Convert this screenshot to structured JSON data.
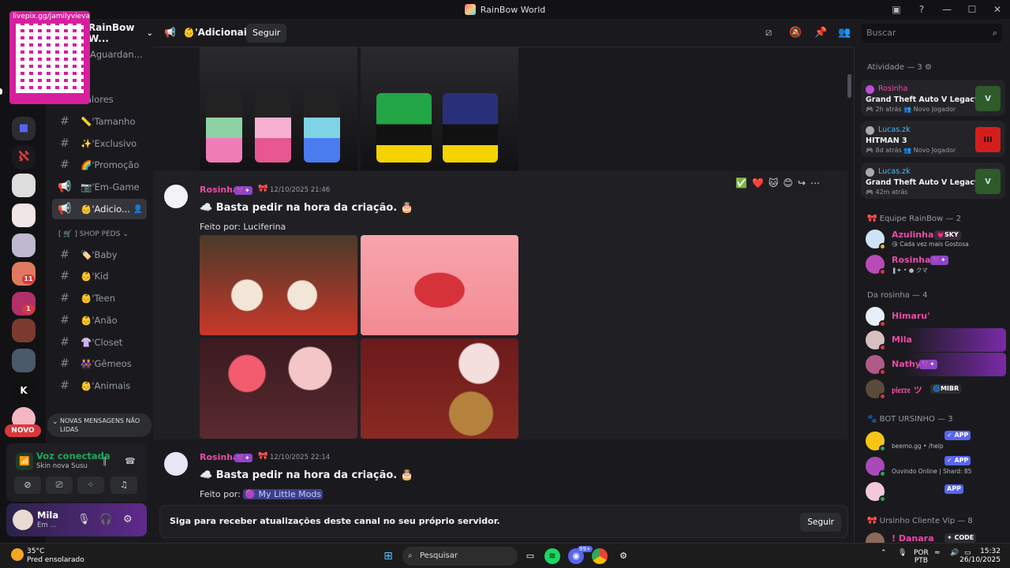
{
  "titlebar": {
    "title": "RainBow World"
  },
  "qr": {
    "url": "livepix.gg/jamilyvieva"
  },
  "server": {
    "name": "RainBow W...",
    "pending": "Aguardan..."
  },
  "rail": {
    "badges": [
      "11",
      "1"
    ],
    "novo": "NOVO"
  },
  "channels": [
    {
      "label": "Valores",
      "icon": ""
    },
    {
      "label": "📏'Tamanho",
      "icon": "#"
    },
    {
      "label": "✨'Exclusivo",
      "icon": "#"
    },
    {
      "label": "🌈'Promoção",
      "icon": "#"
    },
    {
      "label": "📷'Em-Game",
      "icon": "📢"
    },
    {
      "label": "👶'Adicio...",
      "icon": "📢"
    },
    {
      "label": "🏷️'Baby",
      "icon": "#"
    },
    {
      "label": "👶'Kid",
      "icon": "#"
    },
    {
      "label": "👶'Teen",
      "icon": "#"
    },
    {
      "label": "👶'Anão",
      "icon": "#"
    },
    {
      "label": "👚'Closet",
      "icon": "#"
    },
    {
      "label": "👭'Gêmeos",
      "icon": "#"
    },
    {
      "label": "👶'Animais",
      "icon": "#"
    }
  ],
  "category": "[ 🛒 ] SHOP PEDS ⌄",
  "unread_label": "NOVAS MENSAGENS NÃO LIDAS",
  "voice": {
    "status": "Voz conectada",
    "channel": "Skin nova Susu"
  },
  "user": {
    "name": "Mila",
    "status": "Em ..."
  },
  "chat_header": {
    "channel": "👶'Adicionais",
    "follow": "Seguir"
  },
  "search": {
    "placeholder": "Buscar"
  },
  "messages": [
    {
      "author": "Rosinha",
      "time": "12/10/2025 21:46",
      "text": "☁️ Basta pedir na hora da criação. 🎂",
      "credit_prefix": "Feito por:",
      "credit": "Luciferina"
    },
    {
      "author": "Rosinha",
      "time": "12/10/2025 22:14",
      "text": "☁️ Basta pedir na hora da criação. 🎂",
      "credit_prefix": "Feito por:",
      "credit": "🟣 My Little Mods"
    }
  ],
  "reactions": [
    "✅",
    "❤️",
    "🐱",
    "😊",
    "↪",
    "⋯"
  ],
  "notice": {
    "text": "Siga para receber atualizações deste canal no seu próprio servidor.",
    "button": "Seguir"
  },
  "members": {
    "activity_title": "Atividade — 3",
    "activities": [
      {
        "user": "Rosinha",
        "game": "Grand Theft Auto V Legacy",
        "meta": "🎮 2h atrás  👥 Novo Jogador",
        "icon": "V"
      },
      {
        "user": "Lucas.zk",
        "game": "HITMAN 3",
        "meta": "🎮 8d atrás  👥 Novo Jogador",
        "icon": "III"
      },
      {
        "user": "Lucas.zk",
        "game": "Grand Theft Auto V Legacy",
        "meta": "🎮 42m atrás",
        "icon": "V"
      }
    ],
    "group1_title": "🎀 Equipe RainBow — 2",
    "group1": [
      {
        "name": "Azulinha",
        "badge": "💗SKY",
        "status": "😘 Cada vez mais Gostosa"
      },
      {
        "name": "Rosinha",
        "badge": "💜✦",
        "status": "❚✦ • ● クマ"
      }
    ],
    "group2_title": "Da rosinha — 4",
    "group2": [
      {
        "name": "Himaru'",
        "badge": ""
      },
      {
        "name": "Mila",
        "badge": ""
      },
      {
        "name": "Nathy",
        "badge": "💜✦"
      },
      {
        "name": "𝔭𝔦𝔢𝔯𝔯𝔢 ツ",
        "badge": "🌀MIBR"
      }
    ],
    "group3_title": "🐾 BOT URSINHO — 3",
    "group3": [
      {
        "name": "",
        "badge": "✓ APP",
        "status": "beemo.gg • /help"
      },
      {
        "name": "",
        "badge": "✓ APP",
        "status": "Ouvindo Online | Shard: 85"
      },
      {
        "name": "",
        "badge": "APP",
        "status": ""
      }
    ],
    "group4_title": "🎀 Ursinho Cliente Vip — 8",
    "group4": [
      {
        "name": "! Danara",
        "badge": "✦ CODE"
      }
    ]
  },
  "taskbar": {
    "weather_temp": "35°C",
    "weather_desc": "Pred ensolarado",
    "search": "Pesquisar",
    "lang": "POR",
    "kb": "PTB",
    "time": "15:32",
    "date": "26/10/2025",
    "discord_badge": "99+"
  },
  "colors": {
    "pink": "#ea4aa8",
    "accent": "#5865f2",
    "online": "#23a55a",
    "dnd": "#da373c"
  }
}
